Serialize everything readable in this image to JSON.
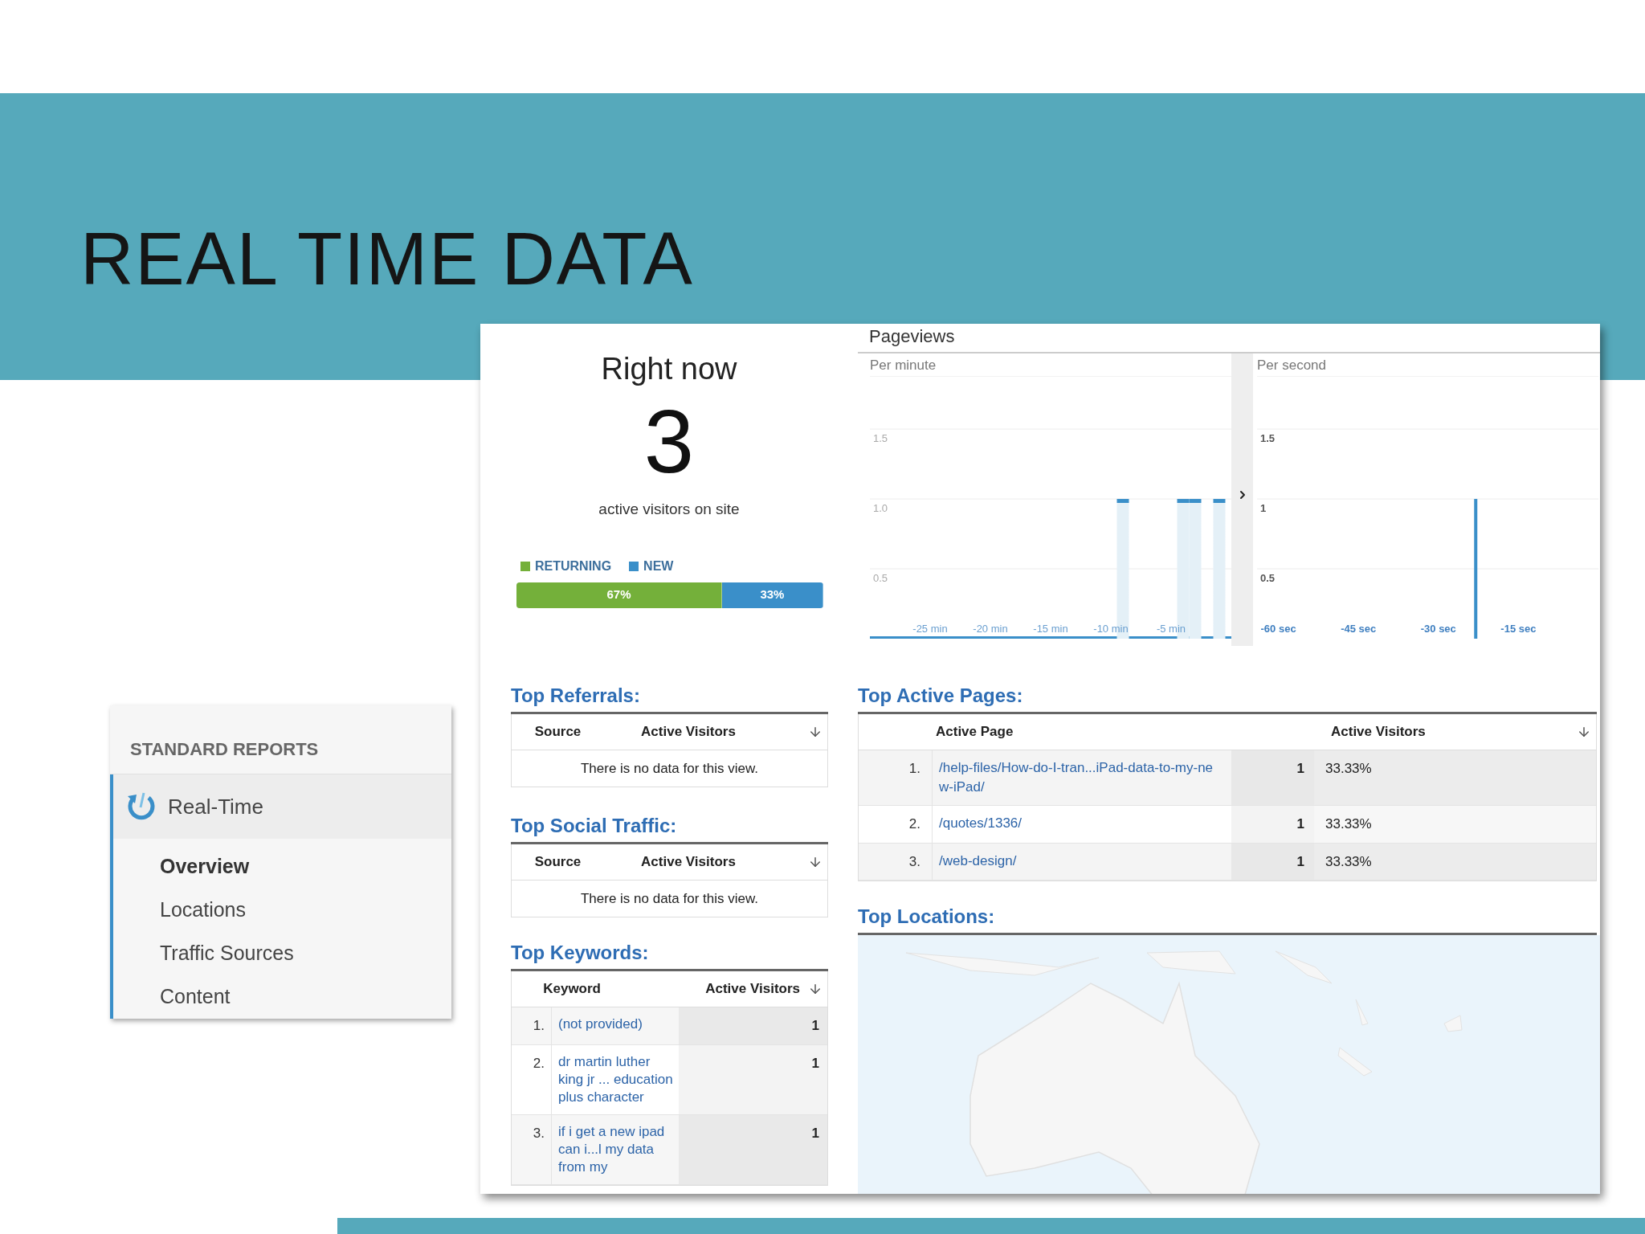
{
  "slide": {
    "title": "REAL TIME DATA"
  },
  "sidebar": {
    "heading": "STANDARD REPORTS",
    "section": "Real-Time",
    "items": [
      {
        "label": "Overview",
        "selected": true
      },
      {
        "label": "Locations",
        "selected": false
      },
      {
        "label": "Traffic Sources",
        "selected": false
      },
      {
        "label": "Content",
        "selected": false
      }
    ]
  },
  "right_now": {
    "title": "Right now",
    "count": "3",
    "caption": "active visitors on site",
    "segments": [
      {
        "label": "RETURNING",
        "color": "#74b03a",
        "share": "67%",
        "level": 0.67
      },
      {
        "label": "NEW",
        "color": "#3a8fc9",
        "share": "33%",
        "level": 0.33
      }
    ]
  },
  "pageviews": {
    "title": "Pageviews",
    "panels": [
      {
        "label": "Per minute",
        "chart_data": {
          "type": "bar",
          "x": [
            -30,
            -29,
            -28,
            -27,
            -26,
            -25,
            -24,
            -23,
            -22,
            -21,
            -20,
            -19,
            -18,
            -17,
            -16,
            -15,
            -14,
            -13,
            -12,
            -11,
            -10,
            -9,
            -8,
            -7,
            -6,
            -5,
            -4,
            -3,
            -2,
            -1
          ],
          "values": [
            0,
            0,
            0,
            0,
            0,
            0,
            0,
            0,
            0,
            0,
            0,
            0,
            0,
            0,
            0,
            0,
            0,
            0,
            0,
            0,
            0,
            1,
            0,
            0,
            0,
            0,
            1,
            1,
            0,
            1
          ],
          "xlim": [
            -30,
            0
          ],
          "ylim": [
            0,
            1.88
          ],
          "grid": true,
          "yticks": [
            0.5,
            {
              "value": 1,
              "label": "1.0"
            },
            1.5
          ],
          "xticks": [
            {
              "value": -25,
              "label": "-25 min"
            },
            {
              "value": -20,
              "label": "-20 min"
            },
            {
              "value": -15,
              "label": "-15 min"
            },
            {
              "value": -10,
              "label": "-10 min"
            },
            {
              "value": -5,
              "label": "-5 min"
            }
          ]
        }
      },
      {
        "label": "Per second",
        "chart_data": {
          "type": "bar",
          "x": [
            -23
          ],
          "values": [
            1
          ],
          "xlim": [
            -64,
            0
          ],
          "ylim": [
            0,
            1.88
          ],
          "grid": true,
          "yticks": [
            0.5,
            1,
            1.5
          ],
          "xticks": [
            {
              "value": -60,
              "label": "-60 sec"
            },
            {
              "value": -45,
              "label": "-45 sec"
            },
            {
              "value": -30,
              "label": "-30 sec"
            },
            {
              "value": -15,
              "label": "-15 sec"
            }
          ]
        }
      }
    ]
  },
  "top_referrals": {
    "title": "Top Referrals:",
    "columns": [
      "Source",
      "Active Visitors"
    ],
    "empty_message": "There is no data for this view."
  },
  "top_social_traffic": {
    "title": "Top Social Traffic:",
    "columns": [
      "Source",
      "Active Visitors"
    ],
    "empty_message": "There is no data for this view."
  },
  "top_keywords": {
    "title": "Top Keywords:",
    "columns": [
      "Keyword",
      "Active Visitors"
    ],
    "rows": [
      {
        "rank": "1.",
        "keyword": "(not provided)",
        "visitors": "1"
      },
      {
        "rank": "2.",
        "keyword": "dr martin luther king jr ... education plus character",
        "visitors": "1"
      },
      {
        "rank": "3.",
        "keyword": "if i get a new ipad can i...l my data from my",
        "visitors": "1"
      }
    ]
  },
  "top_active_pages": {
    "title": "Top Active Pages:",
    "columns": [
      "Active Page",
      "Active Visitors"
    ],
    "rows": [
      {
        "rank": "1.",
        "page": "/help-files/How-do-I-tran...iPad-data-to-my-new-iPad/",
        "visitors": "1",
        "share": "33.33%"
      },
      {
        "rank": "2.",
        "page": "/quotes/1336/",
        "visitors": "1",
        "share": "33.33%"
      },
      {
        "rank": "3.",
        "page": "/web-design/",
        "visitors": "1",
        "share": "33.33%"
      }
    ]
  },
  "top_locations": {
    "title": "Top Locations:"
  }
}
